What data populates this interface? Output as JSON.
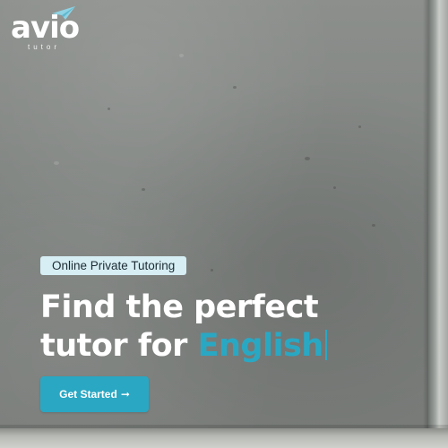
{
  "brand": {
    "name": "avio",
    "tagline": "tutor",
    "logo_icon": "paper-plane-icon",
    "plane_color": "#8fd3e4"
  },
  "hero": {
    "badge": "Online Private Tutoring",
    "headline_line1": "Find the perfect",
    "headline_line2_prefix": "tutor for",
    "headline_highlight": "English",
    "cta_label": "Get Started",
    "cta_icon": "arrow-right-icon",
    "cta_arrow": "➞"
  },
  "colors": {
    "accent": "#29a8c4",
    "badge_bg": "#d6eef4",
    "headline": "#ffffff"
  }
}
